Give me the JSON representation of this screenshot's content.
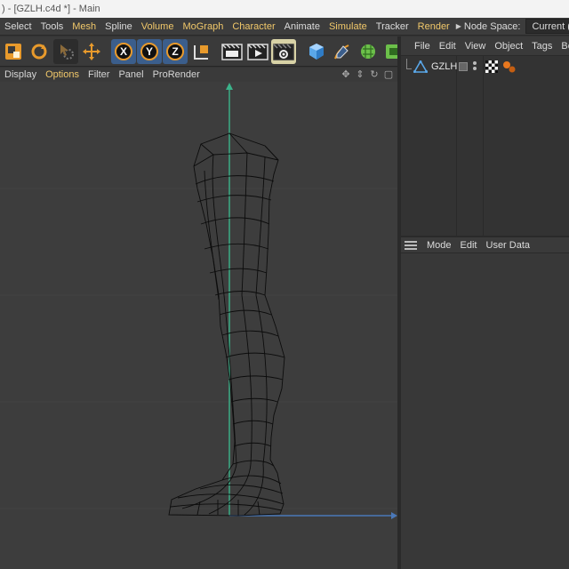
{
  "window": {
    "title": ") - [GZLH.c4d *] - Main"
  },
  "menubar": {
    "items": [
      {
        "label": "Select",
        "hl": false
      },
      {
        "label": "Tools",
        "hl": false
      },
      {
        "label": "Mesh",
        "hl": true
      },
      {
        "label": "Spline",
        "hl": false
      },
      {
        "label": "Volume",
        "hl": true
      },
      {
        "label": "MoGraph",
        "hl": true
      },
      {
        "label": "Character",
        "hl": true
      },
      {
        "label": "Animate",
        "hl": false
      },
      {
        "label": "Simulate",
        "hl": true
      },
      {
        "label": "Tracker",
        "hl": false
      },
      {
        "label": "Render",
        "hl": true
      }
    ],
    "node_space_label": "Node Space:",
    "node_space_value": "Current (Standard/Physical)"
  },
  "toolbar": {
    "icons": [
      "move-mode-icon",
      "rotate-icon",
      "live-selection-icon",
      "move-tool-icon",
      "axis-x-icon",
      "axis-y-icon",
      "axis-z-icon",
      "coordinate-system-icon",
      "render-view-icon",
      "render-picture-viewer-icon",
      "render-settings-icon",
      "cube-primitive-icon",
      "pen-tool-icon",
      "subdivision-icon",
      "deformer-icon"
    ],
    "axis_x": "X",
    "axis_y": "Y",
    "axis_z": "Z"
  },
  "viewport": {
    "menu": [
      "Display",
      "Options",
      "Filter",
      "Panel",
      "ProRender"
    ],
    "menu_highlight": "Options",
    "nav_icons": [
      "pan-icon",
      "dolly-icon",
      "rotate-view-icon",
      "maximize-view-icon"
    ],
    "axis_y_color": "#3bb38a",
    "axis_x_color": "#4a78b8",
    "grid_color": "#4a4a4a",
    "wire_color": "#0c0c0c"
  },
  "object_manager": {
    "menu": [
      "File",
      "Edit",
      "View",
      "Object",
      "Tags",
      "Bookmarks"
    ],
    "objects": [
      {
        "name": "GZLH"
      }
    ]
  },
  "attribute_manager": {
    "menu": [
      "Mode",
      "Edit",
      "User Data"
    ]
  },
  "colors": {
    "highlight_text": "#f1c86a",
    "background": "#333333",
    "toolbar_orange": "#e89a2c"
  }
}
